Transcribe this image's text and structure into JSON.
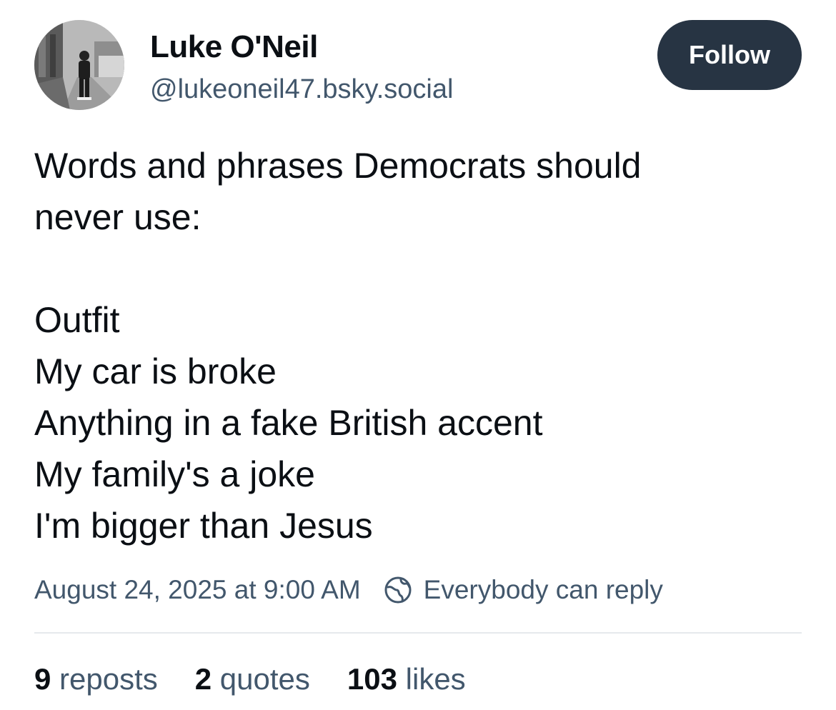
{
  "author": {
    "display_name": "Luke O'Neil",
    "handle": "@lukeoneil47.bsky.social",
    "avatar_icon": "profile-photo"
  },
  "follow_button": {
    "label": "Follow",
    "background": "#273443"
  },
  "post": {
    "lines": [
      "Words and phrases Democrats should",
      "never use:",
      "",
      "Outfit",
      "My car is broke",
      "Anything in a fake British accent",
      "My family's a joke",
      "I'm bigger than Jesus"
    ]
  },
  "meta": {
    "timestamp": "August 24, 2025 at 9:00 AM",
    "reply_setting_icon": "globe-icon",
    "reply_setting": "Everybody can reply"
  },
  "stats": {
    "reposts": {
      "count": "9",
      "label": "reposts"
    },
    "quotes": {
      "count": "2",
      "label": "quotes"
    },
    "likes": {
      "count": "103",
      "label": "likes"
    }
  },
  "colors": {
    "text": "#0b0f14",
    "muted": "#42576c",
    "divider": "#e6e9ec"
  }
}
